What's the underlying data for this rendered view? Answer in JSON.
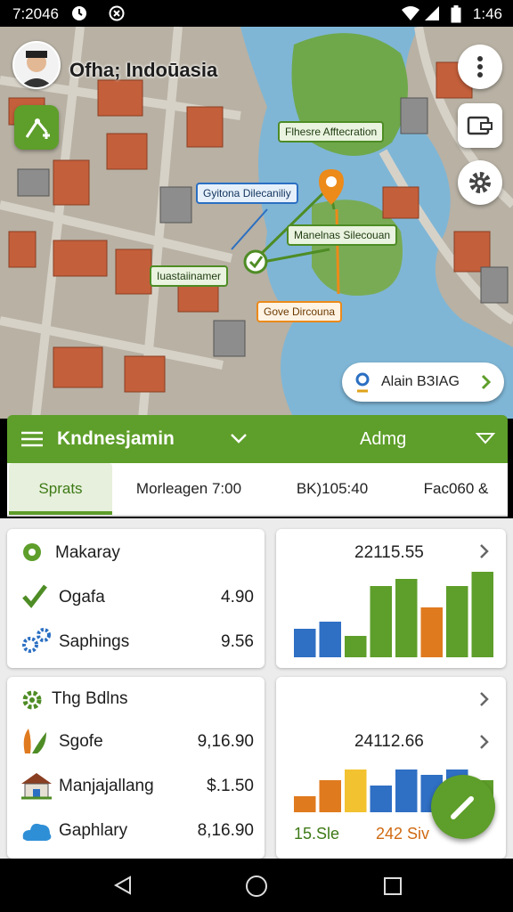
{
  "status_bar": {
    "time_left": "7:2046",
    "time_right": "1:46"
  },
  "app": {
    "title": "Ofha; Indoūasia"
  },
  "map": {
    "callouts": {
      "top_green": "Flhesre Afftecration",
      "blue": "Gyitona Dilecaniliy",
      "mid_green": "Manelnas Silecouan",
      "left_green": "Iuastaiinamer",
      "orange": "Gove Dircouna"
    },
    "destination": "Alain BЗIAG"
  },
  "header": {
    "title": "Kndnesjamin",
    "right_title": "Admg"
  },
  "tabs": [
    "Sprats",
    "Morleagen 7:00",
    "BK)105:40",
    "Fac060 &"
  ],
  "card_top_left": {
    "title": "Makaray",
    "rows": [
      {
        "label": "Ogafa",
        "value": "4.90"
      },
      {
        "label": "Saphings",
        "value": "9.56"
      }
    ]
  },
  "card_top_right": {
    "value": "22115.55"
  },
  "card_bottom_left": {
    "title": "Thg Bdlns",
    "rows": [
      {
        "label": "Sgofe",
        "value": "9,16.90"
      },
      {
        "label": "Manjajallang",
        "value": "$.1.50"
      },
      {
        "label": "Gaphlary",
        "value": "8,16.90"
      }
    ]
  },
  "card_bottom_right": {
    "value": "24112.66",
    "legend_left": "15.Sle",
    "legend_right": "242 Siv"
  },
  "colors": {
    "accent": "#5e9e2a",
    "blue": "#2f6fc4",
    "orange": "#e07a1f",
    "yellow": "#f2c230"
  },
  "icons": [
    "avatar",
    "route-icon",
    "more-vert-icon",
    "wallet-icon",
    "settings-gear-icon",
    "location-pin-icon",
    "chevron-right-icon",
    "menu-icon",
    "edit-pencil-icon"
  ],
  "chart_data": [
    {
      "type": "bar",
      "categories": [
        "1",
        "2",
        "3",
        "4",
        "5",
        "6",
        "7",
        "8"
      ],
      "values": [
        4,
        5,
        3,
        10,
        11,
        7,
        10,
        12
      ],
      "colors": [
        "#2f6fc4",
        "#2f6fc4",
        "#5e9e2a",
        "#5e9e2a",
        "#5e9e2a",
        "#e07a1f",
        "#5e9e2a",
        "#5e9e2a"
      ],
      "ylim": [
        0,
        12
      ]
    },
    {
      "type": "bar",
      "categories": [
        "1",
        "2",
        "3",
        "4",
        "5",
        "6",
        "7",
        "8"
      ],
      "values": [
        3,
        6,
        8,
        5,
        8,
        7,
        8,
        6
      ],
      "colors": [
        "#e07a1f",
        "#e07a1f",
        "#f2c230",
        "#2f6fc4",
        "#2f6fc4",
        "#2f6fc4",
        "#2f6fc4",
        "#5e9e2a"
      ],
      "ylim": [
        0,
        10
      ]
    }
  ]
}
